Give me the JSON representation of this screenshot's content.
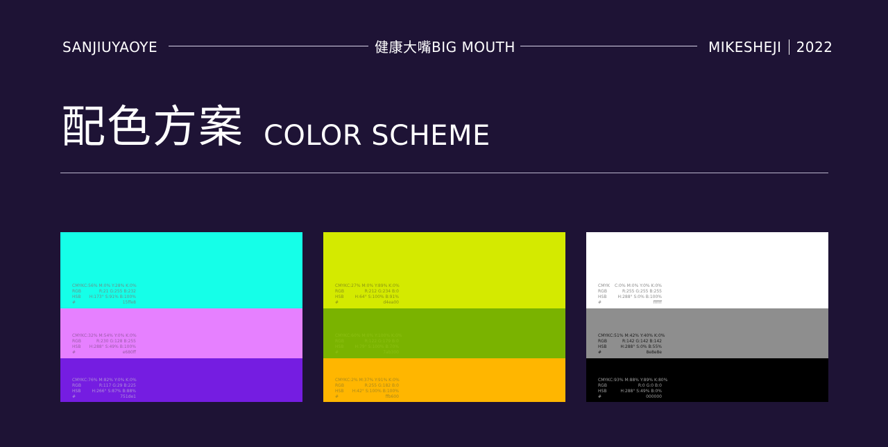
{
  "header": {
    "left": "SANJIUYAOYE",
    "center": "健康大嘴BIG MOUTH",
    "brand": "MIKESHEJI",
    "year": "2022"
  },
  "title": {
    "cn": "配色方案",
    "en": "COLOR SCHEME"
  },
  "labels": {
    "cmyk": "CMYK",
    "rgb": "RGB",
    "hsb": "HSB",
    "hex": "#"
  },
  "cards": [
    {
      "swatches": [
        {
          "color": "#15ffe8",
          "text_color": "#6b8f8b",
          "cmyk": "C:56% M:0% Y:28% K:0%",
          "rgb": "R:21 G:255 B:232",
          "hsb": "H:173° S:91% B:100%",
          "hex": "15ffe8"
        },
        {
          "color": "#e680ff",
          "text_color": "#9a5aa6",
          "cmyk": "C:32% M:54% Y:0% K:0%",
          "rgb": "R:230 G:128 B:255",
          "hsb": "H:288° S:49% B:100%",
          "hex": "e680ff"
        },
        {
          "color": "#751de1",
          "text_color": "#b090d8",
          "cmyk": "C:76% M:82% Y:0% K:0%",
          "rgb": "R:117 G:29 B:225",
          "hsb": "H:266° S:87% B:88%",
          "hex": "751de1"
        }
      ]
    },
    {
      "swatches": [
        {
          "color": "#d4ea00",
          "text_color": "#8a9414",
          "cmyk": "C:27% M:0% Y:89% K:0%",
          "rgb": "R:212 G:234 B:0",
          "hsb": "H:64° S:100% B:91%",
          "hex": "d4ea00"
        },
        {
          "color": "#7ab300",
          "text_color": "#8cbf12",
          "cmyk": "C:60% M:0% Y:100% K:0%",
          "rgb": "R:122 G:179 B:0",
          "hsb": "H:79° S:100% B:70%",
          "hex": "7ab300"
        },
        {
          "color": "#ffb600",
          "text_color": "#a8881e",
          "cmyk": "C:2% M:37% Y:91% K:0%",
          "rgb": "R:255 G:182 B:0",
          "hsb": "H:42° S:100% B:100%",
          "hex": "ffb600"
        }
      ]
    },
    {
      "swatches": [
        {
          "color": "#ffffff",
          "text_color": "#8a8a8a",
          "cmyk": "C:0% M:0% Y:0% K:0%",
          "rgb": "R:255 G:255 B:255",
          "hsb": "H:288° S:0% B:100%",
          "hex": "ffffff"
        },
        {
          "color": "#8e8e8e",
          "text_color": "#1a1a1a",
          "cmyk": "C:51% M:42% Y:40% K:0%",
          "rgb": "R:142 G:142 B:142",
          "hsb": "H:288° S:0% B:55%",
          "hex": "8e8e8e"
        },
        {
          "color": "#000000",
          "text_color": "#a0a0a0",
          "cmyk": "C:93% M:88% Y:89% K:80%",
          "rgb": "R:0 G:0 B:0",
          "hsb": "H:288° S:49% B:0%",
          "hex": "000000"
        }
      ]
    }
  ]
}
